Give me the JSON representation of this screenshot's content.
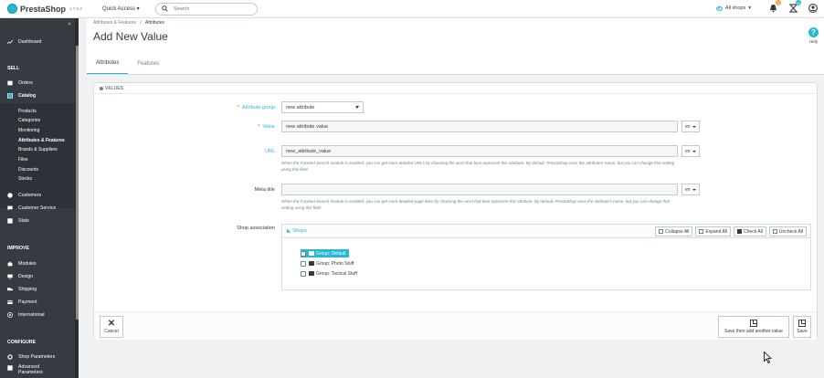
{
  "app": {
    "brand": "PrestaShop",
    "version": "1.7.6.4"
  },
  "topbar": {
    "quick_access": "Quick Access ▾",
    "search_placeholder": "Search",
    "all_shops": "All shops",
    "orders_badge": "1",
    "customers_badge": "10"
  },
  "sidebar": {
    "dashboard": "Dashboard",
    "sell": "SELL",
    "orders": "Orders",
    "catalog": "Catalog",
    "catalog_items": [
      "Products",
      "Categories",
      "Monitoring",
      "Attributes & Features",
      "Brands & Suppliers",
      "Files",
      "Discounts",
      "Stocks"
    ],
    "customers": "Customers",
    "customer_service": "Customer Service",
    "stats": "Stats",
    "improve": "IMPROVE",
    "modules": "Modules",
    "design": "Design",
    "shipping": "Shipping",
    "payment": "Payment",
    "international": "International",
    "configure": "CONFIGURE",
    "shop_parameters": "Shop Parameters",
    "advanced": "Advanced",
    "advanced_2": "Parameters"
  },
  "header": {
    "breadcrumb_1": "Attributes & Features",
    "breadcrumb_sep": "/",
    "breadcrumb_2": "Attributes",
    "title": "Add New Value",
    "help": "Help"
  },
  "tabs": [
    "Attributes",
    "Features"
  ],
  "panel": {
    "heading": "VALUES",
    "attribute_group_label": "Attribute group",
    "attribute_group_value": "new attribute",
    "value_label": "Value",
    "value_value": "new attribute value",
    "url_label": "URL",
    "url_value": "new_attribute_value",
    "url_help": "When the Faceted Search module is enabled, you can get more detailed URLs by choosing the word that best represent this attribute. By default, PrestaShop uses the attribute's name, but you can change that setting using this field.",
    "meta_title_label": "Meta title",
    "meta_title_value": "",
    "meta_help": "When the Faceted Search module is enabled, you can get more detailed page titles by choosing the word that best represent this attribute. By default, PrestaShop uses the attribute's name, but you can change that setting using this field.",
    "lang": "en",
    "required_mark": "*",
    "shop_association_label": "Shop association",
    "tree_root": "Shops",
    "collapse_all": "Collapse All",
    "expand_all": "Expand All",
    "check_all": "Check All",
    "uncheck_all": "Uncheck All",
    "tree_items": [
      "Group: Default",
      "Group: Photo Stuff",
      "Group: Tactical Stuff"
    ]
  },
  "footer": {
    "cancel": "Cancel",
    "save_add": "Save then add another value",
    "save": "Save"
  },
  "colors": {
    "accent": "#25b9d7",
    "sidebar": "#363a41"
  }
}
